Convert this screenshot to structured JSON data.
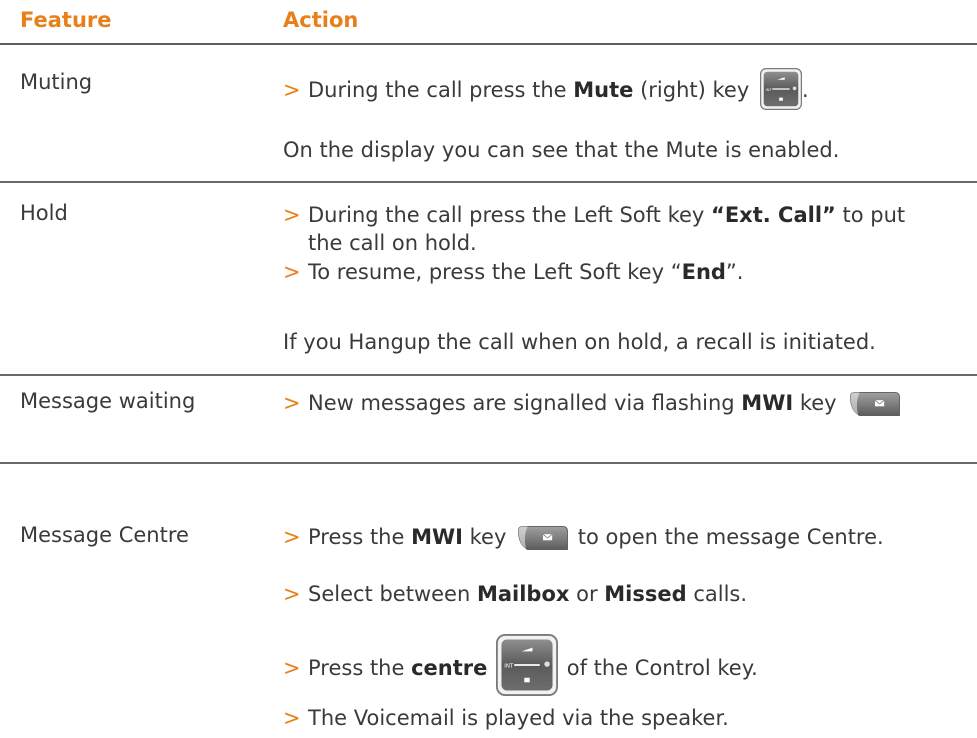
{
  "header": {
    "feature": "Feature",
    "action": "Action"
  },
  "icons": {
    "bullet": "chevron-right-icon",
    "control_key": "control-key-icon",
    "mwi_key": "mwi-key-icon"
  },
  "colors": {
    "accent": "#e8801a",
    "text": "#3a3a3a",
    "rule": "#5f5f5f"
  },
  "rows": [
    {
      "feature": "Muting",
      "bullet": ">",
      "l1a": "During the call press the ",
      "l1b": "Mute",
      "l1c": " (right) key",
      "l1d": ".",
      "note": "On the display you can see that the Mute is enabled."
    },
    {
      "feature": "Hold",
      "bullet": ">",
      "l1a": "During the call press the Left Soft key ",
      "l1b": "“Ext. Call”",
      "l1c": " to put",
      "l2": "the call on hold.",
      "l3a": "To resume, press the Left Soft key “",
      "l3b": "End",
      "l3c": "”.",
      "note": "If you Hangup the call when on hold, a recall is initiated."
    },
    {
      "feature": "Message waiting",
      "bullet": ">",
      "l1a": "New messages are signalled via flashing ",
      "l1b": "MWI",
      "l1c": " key"
    },
    {
      "feature": "Message Centre",
      "bullet": ">",
      "l1a": "Press the ",
      "l1b": "MWI",
      "l1c": " key",
      "l1d": " to open the message Centre.",
      "l2a": "Select between ",
      "l2b": "Mailbox",
      "l2c": " or ",
      "l2d": "Missed",
      "l2e": " calls.",
      "l3a": "Press the ",
      "l3b": "centre",
      "l3c": " of the Control key.",
      "l4": "The Voicemail is played via the speaker."
    }
  ]
}
